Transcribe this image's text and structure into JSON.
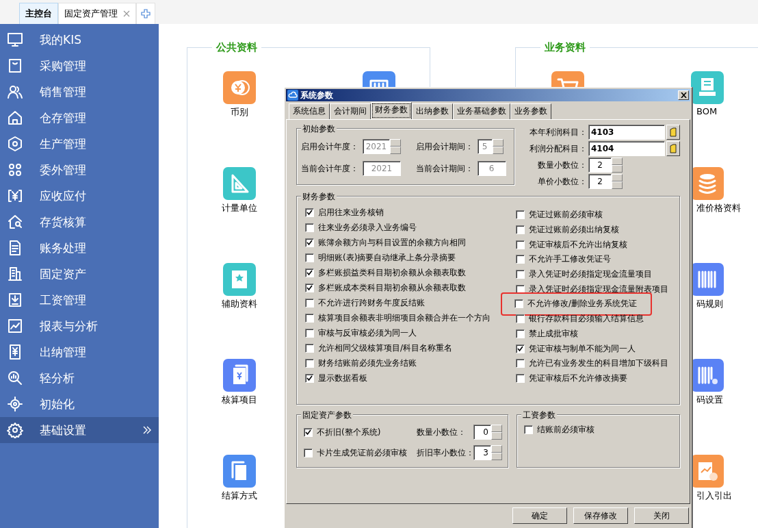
{
  "tabs": [
    {
      "label": "主控台",
      "selected": true,
      "closable": false
    },
    {
      "label": "固定资产管理",
      "selected": false,
      "closable": true
    }
  ],
  "sidebar": {
    "items": [
      {
        "label": "我的KIS",
        "selected": false
      },
      {
        "label": "采购管理",
        "selected": false
      },
      {
        "label": "销售管理",
        "selected": false
      },
      {
        "label": "仓存管理",
        "selected": false
      },
      {
        "label": "生产管理",
        "selected": false
      },
      {
        "label": "委外管理",
        "selected": false
      },
      {
        "label": "应收应付",
        "selected": false
      },
      {
        "label": "存货核算",
        "selected": false
      },
      {
        "label": "账务处理",
        "selected": false
      },
      {
        "label": "固定资产",
        "selected": false
      },
      {
        "label": "工资管理",
        "selected": false
      },
      {
        "label": "报表与分析",
        "selected": false
      },
      {
        "label": "出纳管理",
        "selected": false
      },
      {
        "label": "轻分析",
        "selected": false
      },
      {
        "label": "初始化",
        "selected": false
      },
      {
        "label": "基础设置",
        "selected": true
      }
    ]
  },
  "panels": [
    {
      "title": "公共资料",
      "columns": [
        [
          {
            "label": "币别",
            "color": "#f7954a"
          },
          {
            "label": "计量单位",
            "color": "#3cc6c8"
          },
          {
            "label": "辅助资料",
            "color": "#3cc6c8"
          },
          {
            "label": "核算项目",
            "color": "#5a82f5"
          },
          {
            "label": "结算方式",
            "color": "#4d8cf0"
          }
        ],
        [
          {
            "color": "#4d8cf0"
          }
        ]
      ]
    },
    {
      "title": "业务资料",
      "columns": [
        [
          {
            "color": "#f7954a"
          }
        ],
        [
          {
            "label": "BOM",
            "color": "#3cc6c8"
          },
          {
            "label": "准价格资料",
            "color": "#f7954a"
          },
          {
            "label": "码规则",
            "color": "#5a82f5"
          },
          {
            "label": "码设置",
            "color": "#5a82f5"
          },
          {
            "label": "引入引出",
            "color": "#f7954a"
          }
        ]
      ]
    }
  ],
  "dialog": {
    "title": "系统参数",
    "tabs": [
      {
        "label": "系统信息",
        "selected": false
      },
      {
        "label": "会计期间",
        "selected": false
      },
      {
        "label": "财务参数",
        "selected": true
      },
      {
        "label": "出纳参数",
        "selected": false
      },
      {
        "label": "业务基础参数",
        "selected": false
      },
      {
        "label": "业务参数",
        "selected": false
      }
    ],
    "initial": {
      "title": "初始参数",
      "fields": [
        {
          "label": "启用会计年度：",
          "value": "2021",
          "disabled": true,
          "spinner": true
        },
        {
          "label": "启用会计期间：",
          "value": "5",
          "disabled": true,
          "spinner": true
        },
        {
          "label": "当前会计年度：",
          "value": "2021",
          "disabled": true,
          "spinner": false
        },
        {
          "label": "当前会计期间：",
          "value": "6",
          "disabled": true,
          "spinner": false
        }
      ]
    },
    "accounts": [
      {
        "label": "本年利润科目：",
        "value": "4103"
      },
      {
        "label": "利润分配科目：",
        "value": "4104"
      }
    ],
    "decimals": [
      {
        "label": "数量小数位：",
        "value": "2"
      },
      {
        "label": "单价小数位：",
        "value": "2"
      }
    ],
    "finance": {
      "title": "财务参数",
      "left": [
        {
          "label": "启用往来业务核销",
          "checked": true
        },
        {
          "label": "往来业务必须录入业务编号",
          "checked": false
        },
        {
          "label": "账簿余额方向与科目设置的余额方向相同",
          "checked": true
        },
        {
          "label": "明细账(表)摘要自动继承上条分录摘要",
          "checked": false
        },
        {
          "label": "多栏账损益类科目期初余额从余额表取数",
          "checked": true
        },
        {
          "label": "多栏账成本类科目期初余额从余额表取数",
          "checked": true
        },
        {
          "label": "不允许进行跨财务年度反结账",
          "checked": false
        },
        {
          "label": "核算项目余额表非明细项目余额合并在一个方向",
          "checked": false
        },
        {
          "label": "审核与反审核必须为同一人",
          "checked": false
        },
        {
          "label": "允许相同父级核算项目/科目名称重名",
          "checked": false
        },
        {
          "label": "财务结账前必须先业务结账",
          "checked": false
        },
        {
          "label": "显示数据看板",
          "checked": true
        }
      ],
      "right": [
        {
          "label": "凭证过账前必须审核",
          "checked": false,
          "highlighted": false
        },
        {
          "label": "凭证过账前必须出纳复核",
          "checked": false,
          "highlighted": false
        },
        {
          "label": "凭证审核后不允许出纳复核",
          "checked": false,
          "highlighted": false
        },
        {
          "label": "不允许手工修改凭证号",
          "checked": false,
          "highlighted": false
        },
        {
          "label": "录入凭证时必须指定现金流量项目",
          "checked": false,
          "highlighted": false
        },
        {
          "label": "录入凭证时必须指定现金流量附表项目",
          "checked": false,
          "highlighted": false
        },
        {
          "label": "不允许修改/删除业务系统凭证",
          "checked": false,
          "highlighted": true
        },
        {
          "label": "银行存款科目必须输入结算信息",
          "checked": false,
          "highlighted": false
        },
        {
          "label": "禁止成批审核",
          "checked": false,
          "highlighted": false
        },
        {
          "label": "凭证审核与制单不能为同一人",
          "checked": true,
          "highlighted": false
        },
        {
          "label": "允许已有业务发生的科目增加下级科目",
          "checked": false,
          "highlighted": false
        },
        {
          "label": "凭证审核后不允许修改摘要",
          "checked": false,
          "highlighted": false
        }
      ]
    },
    "fixed_assets": {
      "title": "固定资产参数",
      "options": [
        {
          "label": "不折旧(整个系统)",
          "checked": true
        },
        {
          "label": "卡片生成凭证前必须审核",
          "checked": false
        }
      ],
      "fields": [
        {
          "label": "数量小数位：",
          "value": "0"
        },
        {
          "label": "折旧率小数位：",
          "value": "3"
        }
      ]
    },
    "payroll": {
      "title": "工资参数",
      "options": [
        {
          "label": "结账前必须审核",
          "checked": false
        }
      ]
    },
    "buttons": [
      "确定",
      "保存修改",
      "关闭"
    ]
  }
}
